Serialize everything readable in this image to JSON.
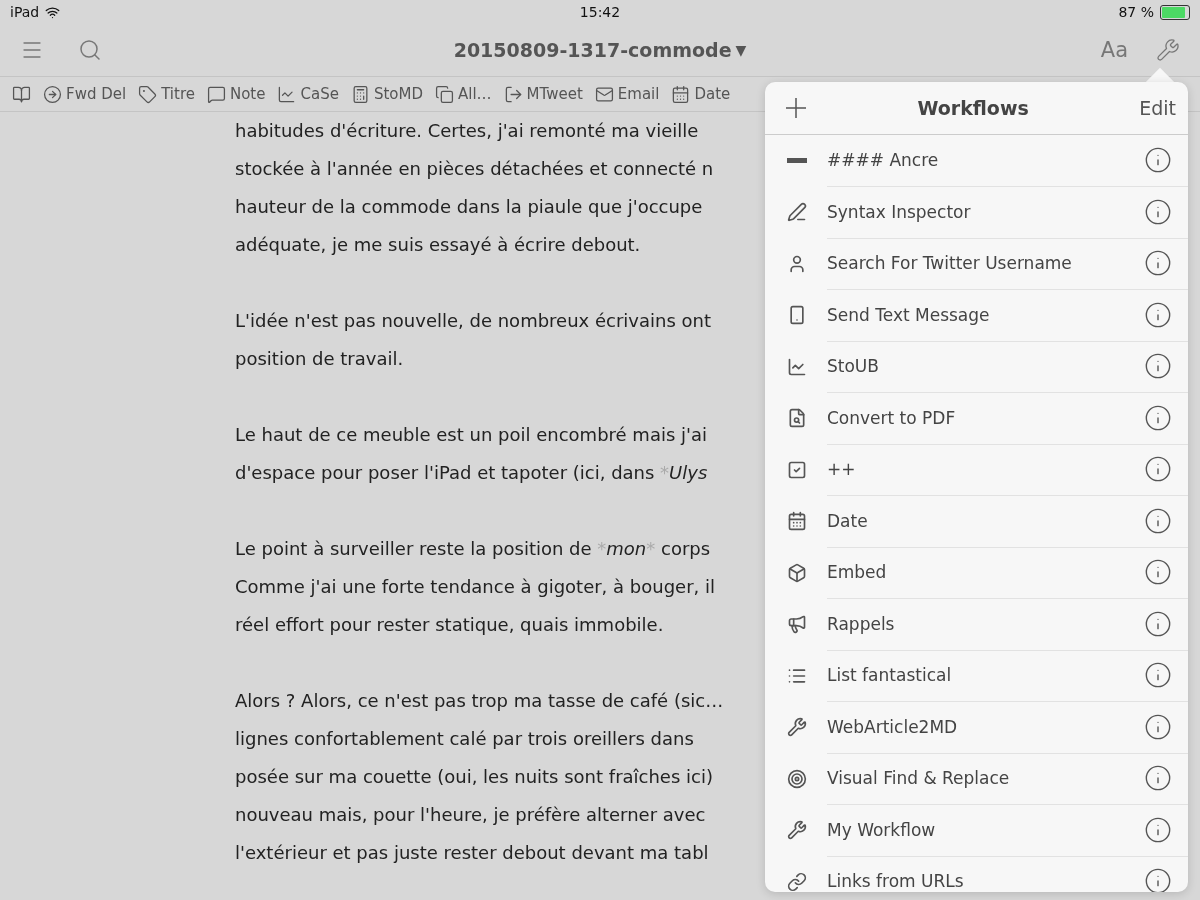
{
  "status_bar": {
    "device": "iPad",
    "time": "15:42",
    "battery": "87 %"
  },
  "top_bar": {
    "title": "20150809-1317-commode",
    "title_caret": "▼",
    "font_button": "Aa"
  },
  "toolbar": [
    {
      "kind": "book"
    },
    {
      "kind": "forward",
      "label": "Fwd Del"
    },
    {
      "kind": "tag",
      "label": "Titre"
    },
    {
      "kind": "note",
      "label": "Note"
    },
    {
      "kind": "chart",
      "label": "CaSe"
    },
    {
      "kind": "register",
      "label": "StoMD"
    },
    {
      "kind": "copy",
      "label": "All…"
    },
    {
      "kind": "export",
      "label": "MTweet"
    },
    {
      "kind": "mail",
      "label": "Email"
    },
    {
      "kind": "calendar",
      "label": "Date"
    }
  ],
  "document": {
    "paragraphs": [
      [
        {
          "runs": [
            {
              "kind": "plain",
              "text": "habitudes d'écriture. Certes, j'ai remonté ma vieille"
            }
          ]
        },
        {
          "runs": [
            {
              "kind": "plain",
              "text": "stockée à l'année en pièces détachées et connecté n"
            }
          ]
        },
        {
          "runs": [
            {
              "kind": "plain",
              "text": "hauteur de la commode dans la piaule que j'occupe"
            }
          ]
        },
        {
          "runs": [
            {
              "kind": "plain",
              "text": "adéquate, je me suis essayé à écrire debout."
            }
          ]
        }
      ],
      [
        {
          "runs": [
            {
              "kind": "plain",
              "text": "L'idée n'est pas nouvelle, de nombreux écrivains ont"
            }
          ]
        },
        {
          "runs": [
            {
              "kind": "plain",
              "text": "position de travail."
            }
          ]
        }
      ],
      [
        {
          "runs": [
            {
              "kind": "plain",
              "text": "Le haut de ce meuble est un poil encombré mais j'ai"
            }
          ]
        },
        {
          "runs": [
            {
              "kind": "plain",
              "text": "d'espace pour poser l'iPad et tapoter (ici, dans "
            },
            {
              "kind": "marker",
              "text": "*"
            },
            {
              "kind": "italic",
              "text": "Ulys"
            }
          ]
        }
      ],
      [
        {
          "runs": [
            {
              "kind": "plain",
              "text": "Le point à surveiller reste la position de "
            },
            {
              "kind": "marker",
              "text": "*"
            },
            {
              "kind": "italic",
              "text": "mon"
            },
            {
              "kind": "marker",
              "text": "*"
            },
            {
              "kind": "plain",
              "text": " corps"
            }
          ]
        },
        {
          "runs": [
            {
              "kind": "plain",
              "text": "Comme j'ai une forte tendance à gigoter, à bouger, il"
            }
          ]
        },
        {
          "runs": [
            {
              "kind": "plain",
              "text": "réel effort pour rester statique, quais immobile."
            }
          ]
        }
      ],
      [
        {
          "runs": [
            {
              "kind": "plain",
              "text": "Alors ? Alors, ce n'est pas trop ma tasse de café (sic…"
            }
          ]
        },
        {
          "runs": [
            {
              "kind": "plain",
              "text": "lignes confortablement calé par trois oreillers dans"
            }
          ]
        },
        {
          "runs": [
            {
              "kind": "plain",
              "text": "posée sur ma couette (oui, les nuits sont fraîches ici)"
            }
          ]
        },
        {
          "runs": [
            {
              "kind": "plain",
              "text": "nouveau mais, pour l'heure, je préfère alterner avec"
            }
          ]
        },
        {
          "runs": [
            {
              "kind": "plain",
              "text": "l'extérieur et pas juste rester debout devant ma tabl"
            }
          ]
        }
      ]
    ]
  },
  "workflows_popover": {
    "title": "Workflows",
    "edit": "Edit",
    "items": [
      {
        "kind": "minus",
        "label": "#### Ancre"
      },
      {
        "kind": "pen",
        "label": "Syntax Inspector"
      },
      {
        "kind": "person",
        "label": "Search For Twitter Username"
      },
      {
        "kind": "phone",
        "label": "Send Text Message"
      },
      {
        "kind": "chart",
        "label": "StoUB"
      },
      {
        "kind": "file-eye",
        "label": "Convert to PDF"
      },
      {
        "kind": "check",
        "label": "++"
      },
      {
        "kind": "calendar",
        "label": "Date"
      },
      {
        "kind": "box",
        "label": "Embed"
      },
      {
        "kind": "megaphone",
        "label": "Rappels"
      },
      {
        "kind": "list",
        "label": "List fantastical"
      },
      {
        "kind": "wrench",
        "label": "WebArticle2MD"
      },
      {
        "kind": "target",
        "label": "Visual Find & Replace"
      },
      {
        "kind": "wrench",
        "label": "My Workflow"
      },
      {
        "kind": "link",
        "label": "Links from URLs"
      }
    ]
  }
}
